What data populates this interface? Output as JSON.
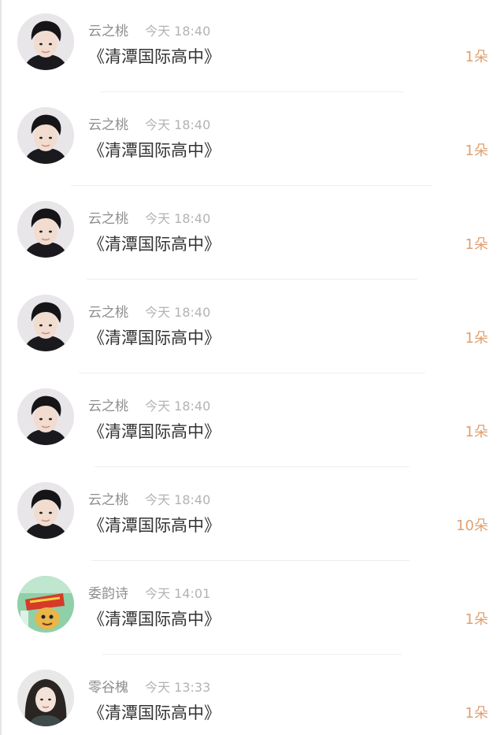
{
  "items": [
    {
      "user": "云之桃",
      "time": "今天 18:40",
      "title": "《清潭国际高中》",
      "count": "1朵",
      "avatar": "young-man-dark-hair"
    },
    {
      "user": "云之桃",
      "time": "今天 18:40",
      "title": "《清潭国际高中》",
      "count": "1朵",
      "avatar": "young-man-dark-hair"
    },
    {
      "user": "云之桃",
      "time": "今天 18:40",
      "title": "《清潭国际高中》",
      "count": "1朵",
      "avatar": "young-man-dark-hair"
    },
    {
      "user": "云之桃",
      "time": "今天 18:40",
      "title": "《清潭国际高中》",
      "count": "1朵",
      "avatar": "young-man-dark-hair"
    },
    {
      "user": "云之桃",
      "time": "今天 18:40",
      "title": "《清潭国际高中》",
      "count": "1朵",
      "avatar": "young-man-dark-hair"
    },
    {
      "user": "云之桃",
      "time": "今天 18:40",
      "title": "《清潭国际高中》",
      "count": "10朵",
      "avatar": "young-man-dark-hair"
    },
    {
      "user": "委韵诗",
      "time": "今天 14:01",
      "title": "《清潭国际高中》",
      "count": "1朵",
      "avatar": "cartoon-sticker"
    },
    {
      "user": "零谷槐",
      "time": "今天 13:33",
      "title": "《清潭国际高中》",
      "count": "1朵",
      "avatar": "woman-long-hair"
    }
  ],
  "colors": {
    "name": "#8e8e8e",
    "time": "#b3b3b3",
    "title": "#333333",
    "count": "#e0a070",
    "divider": "#efefef"
  }
}
